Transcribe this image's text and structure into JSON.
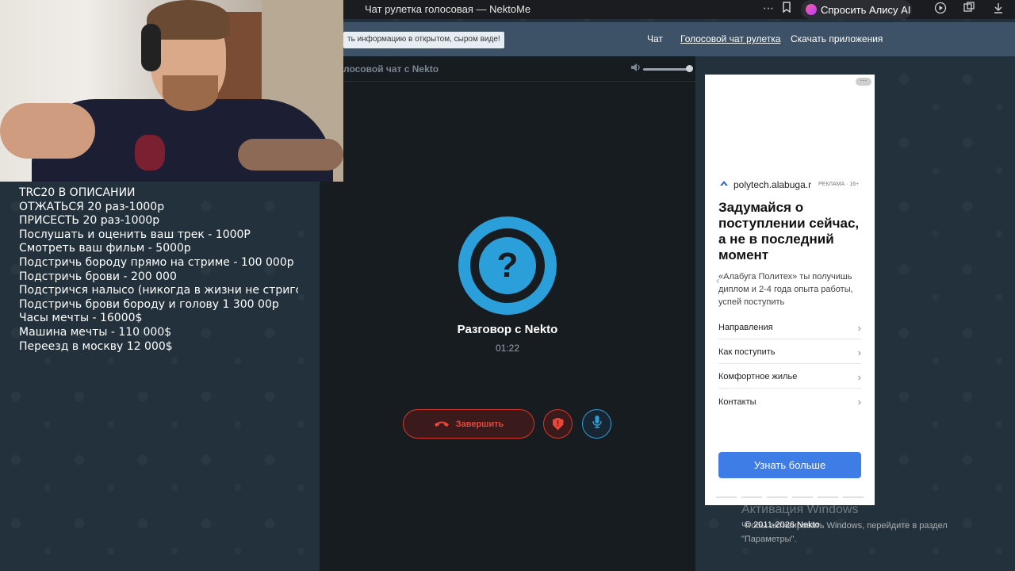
{
  "browser": {
    "title": "Чат рулетка голосовая — NektoMe",
    "alice_label": "Спросить Алису AI",
    "icons": [
      "more-icon",
      "bookmark-icon",
      "alice-icon",
      "play-icon",
      "tabs-icon",
      "download-icon"
    ]
  },
  "site": {
    "banner": "ть информацию в открытом, сыром виде!",
    "nav": [
      "Чат",
      "Голосовой чат рулетка",
      "Скачать приложения"
    ],
    "active_nav": "Голосовой чат рулетка"
  },
  "chat": {
    "panel_title": "лосовой чат с Nekto",
    "avatar_symbol": "?",
    "conversation_title": "Разговор с Nekto",
    "timer": "01:22",
    "end_label": "Завершить",
    "shield_symbol": "!",
    "colors": {
      "accent": "#2b9fd9",
      "danger": "#e8463a"
    }
  },
  "ad": {
    "domain": "polytech.alabuga.r",
    "tag": "РЕКЛАМА · 16+",
    "headline": "Задумайся о поступлении сейчас, а не в последний момент",
    "body": "«Алабуга Политех» ты получишь диплом и 2-4 года опыта работы, успей поступить",
    "links": [
      "Направления",
      "Как поступить",
      "Комфортное жилье",
      "Контакты"
    ],
    "cta": "Узнать больше"
  },
  "overlay": {
    "price_list": [
      "TRC20 В ОПИСАНИИ",
      "ОТЖАТЬСЯ 20 раз-1000р",
      "ПРИСЕСТЬ 20 раз-1000р",
      "Послушать и оценить ваш трек - 1000Р",
      "Смотреть ваш фильм - 5000р",
      "Подстричь бороду прямо на стриме - 100 000р",
      "Подстричь брови - 200 000",
      "Подстричся налысо (никогда в жизни не стригся н",
      "Подстричь брови бороду и голову 1 300 00р",
      "Часы мечты - 16000$",
      "Машина мечты - 110 000$",
      "Переезд в москву 12 000$"
    ]
  },
  "watermark": {
    "title": "Активация Windows",
    "subtitle": "Чтобы активировать Windows, перейдите в раздел \"Параметры\".",
    "copyright": "© 2011-2026 Nekto"
  }
}
